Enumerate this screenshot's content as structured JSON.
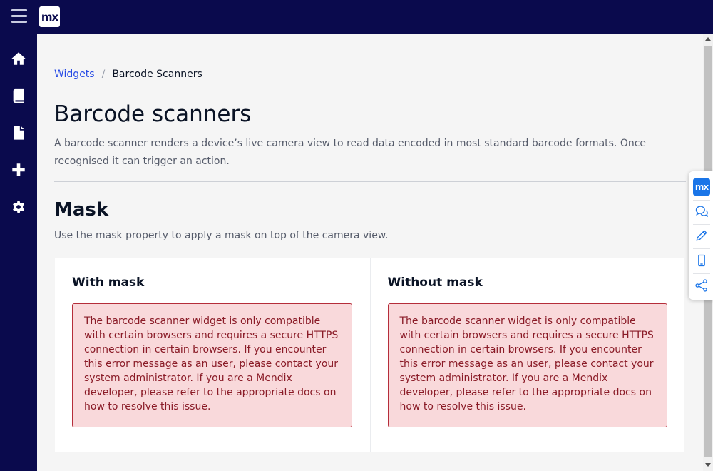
{
  "app": {
    "logo_text": "mx",
    "brand_color": "#0a0a4d"
  },
  "sidebar": {
    "items": [
      {
        "name": "home",
        "icon": "home-icon"
      },
      {
        "name": "book",
        "icon": "book-icon"
      },
      {
        "name": "document",
        "icon": "document-icon"
      },
      {
        "name": "add",
        "icon": "plus-icon"
      },
      {
        "name": "settings",
        "icon": "gear-icon"
      }
    ]
  },
  "breadcrumb": {
    "parent": "Widgets",
    "separator": "/",
    "current": "Barcode Scanners"
  },
  "page": {
    "title": "Barcode scanners",
    "description": "A barcode scanner renders a device’s live camera view to read data encoded in most standard barcode formats. Once recognised it can trigger an action."
  },
  "section": {
    "title": "Mask",
    "description": "Use the mask property to apply a mask on top of the camera view."
  },
  "cards": [
    {
      "title": "With mask",
      "error": "The barcode scanner widget is only compatible with certain browsers and requires a secure HTTPS connection in certain browsers. If you encounter this error message as an user, please contact your system administrator. If you are a Mendix developer, please refer to the appropriate docs on how to resolve this issue."
    },
    {
      "title": "Without mask",
      "error": "The barcode scanner widget is only compatible with certain browsers and requires a secure HTTPS connection in certain browsers. If you encounter this error message as an user, please contact your system administrator. If you are a Mendix developer, please refer to the appropriate docs on how to resolve this issue."
    }
  ],
  "floating_toolbar": {
    "logo_text": "mx",
    "items": [
      "chat-icon",
      "pencil-icon",
      "mobile-icon",
      "share-icon"
    ]
  },
  "colors": {
    "link": "#264ae5",
    "alert_bg": "#f9d9db",
    "alert_border": "#b52d3a",
    "alert_text": "#8a1b27"
  }
}
